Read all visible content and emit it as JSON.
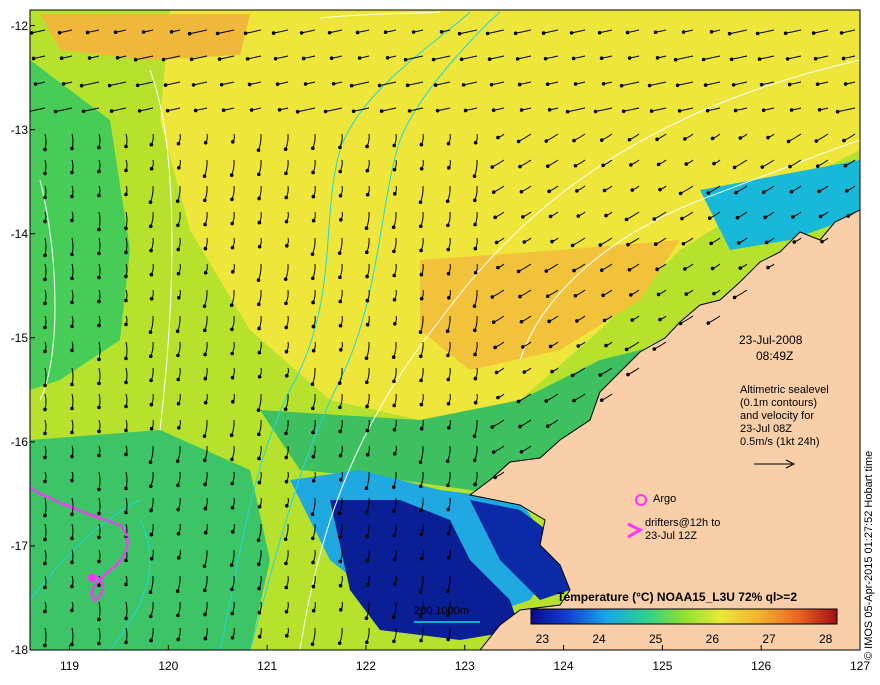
{
  "map": {
    "lon_ticks": [
      "119",
      "120",
      "121",
      "122",
      "123",
      "124",
      "125",
      "126",
      "127"
    ],
    "lat_ticks": [
      "-12",
      "-13",
      "-14",
      "-15",
      "-16",
      "-17",
      "-18"
    ],
    "lon_range": [
      118.6,
      127
    ],
    "lat_range": [
      -11.85,
      -18
    ]
  },
  "annotations": {
    "date": "23-Jul-2008",
    "time": "08:49Z",
    "altimetry_lines": [
      "Altimetric sealevel",
      "(0.1m contours)",
      "and velocity for",
      "23-Jul 08Z",
      "0.5m/s (1kt 24h)"
    ],
    "argo_label": "Argo",
    "drifters_lines": [
      "drifters@12h to",
      "23-Jul 12Z"
    ],
    "depth_legend": "200  1000m",
    "credit": "© IMOS 05-Apr-2015 01:27:52 Hobart time"
  },
  "colorbar": {
    "title": "Temperature (°C) NOAA15_L3U 72% ql>=2",
    "ticks": [
      "23",
      "24",
      "25",
      "26",
      "27",
      "28"
    ],
    "range": [
      22.8,
      28.2
    ]
  },
  "colors": {
    "land": "#f8cfa8",
    "sst_warm": "#f2e23a",
    "sst_mid": "#a8e02a",
    "sst_cool": "#3fc86a",
    "sst_cold": "#12b6d8",
    "sst_coldest": "#0a1f96",
    "drifter": "#ff33ff",
    "depth_contour": "#20d8d8"
  },
  "icons": [
    "argo-float-icon",
    "drifter-track-icon",
    "velocity-vector-icon"
  ]
}
